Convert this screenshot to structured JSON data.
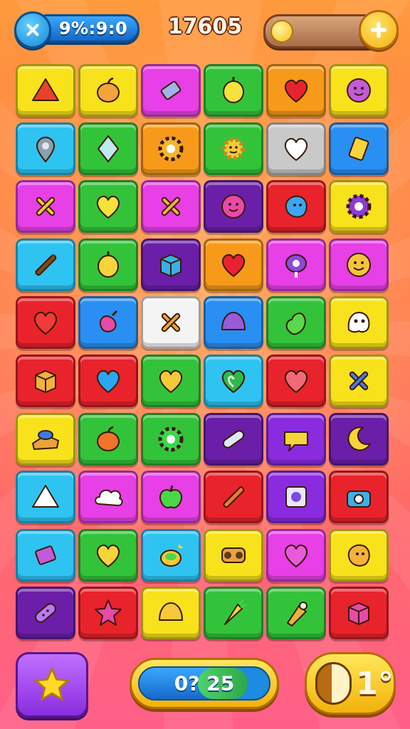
{
  "hud": {
    "timer": "9%:9:0",
    "score": "17605",
    "coins_value": ""
  },
  "colors": {
    "yellow": "#f7e21c",
    "green": "#33c33a",
    "magenta": "#e640e6",
    "orange": "#f79a1a",
    "cyan": "#2fc3f2",
    "purple": "#6b1fa8",
    "red": "#e9232b",
    "white": "#f4f4f4",
    "gray": "#c9c9c9",
    "blue": "#2a8ff2",
    "violet": "#8b2be0"
  },
  "board": {
    "rows": [
      [
        {
          "bg": "yellow",
          "icon": "triangle-gem-icon",
          "c": "#e8432a"
        },
        {
          "bg": "yellow",
          "icon": "fruit-icon",
          "c": "#f2a43a"
        },
        {
          "bg": "magenta",
          "icon": "candy-wrapper-icon",
          "c": "#9fb4e8"
        },
        {
          "bg": "green",
          "icon": "lemon-icon",
          "c": "#f6e23a"
        },
        {
          "bg": "orange",
          "icon": "heart-icon",
          "c": "#e8232f"
        },
        {
          "bg": "yellow",
          "icon": "smiley-gear-icon",
          "c": "#c35bd8"
        }
      ],
      [
        {
          "bg": "cyan",
          "icon": "map-pin-icon",
          "c": "#8aa0ad"
        },
        {
          "bg": "green",
          "icon": "diamond-gem-icon",
          "c": "#bfe8f0"
        },
        {
          "bg": "orange",
          "icon": "gear-icon",
          "c": "#f2b62a"
        },
        {
          "bg": "green",
          "icon": "sun-face-icon",
          "c": "#f6c93a"
        },
        {
          "bg": "gray",
          "icon": "heart-icon",
          "c": "#ffffff"
        },
        {
          "bg": "blue",
          "icon": "tag-icon",
          "c": "#f6d43a"
        }
      ],
      [
        {
          "bg": "magenta",
          "icon": "crossed-sticks-icon",
          "c": "#f2c43a"
        },
        {
          "bg": "green",
          "icon": "heart-icon",
          "c": "#f6e23a"
        },
        {
          "bg": "magenta",
          "icon": "crossed-sticks-icon",
          "c": "#f2b23a"
        },
        {
          "bg": "purple",
          "icon": "smiley-gear-icon",
          "c": "#e84aa8"
        },
        {
          "bg": "red",
          "icon": "blob-face-icon",
          "c": "#3aa7f2"
        },
        {
          "bg": "yellow",
          "icon": "gear-icon",
          "c": "#8b3ad8"
        }
      ],
      [
        {
          "bg": "cyan",
          "icon": "stick-icon",
          "c": "#7a4a1a"
        },
        {
          "bg": "green",
          "icon": "lemon-icon",
          "c": "#f6d43a"
        },
        {
          "bg": "purple",
          "icon": "box-icon",
          "c": "#3ab0e8"
        },
        {
          "bg": "orange",
          "icon": "heart-icon",
          "c": "#e8232f"
        },
        {
          "bg": "magenta",
          "icon": "key-icon",
          "c": "#8b4ad8"
        },
        {
          "bg": "magenta",
          "icon": "smiley-icon",
          "c": "#f6c43a"
        }
      ],
      [
        {
          "bg": "red",
          "icon": "heart-icon",
          "c": "#f13a3a"
        },
        {
          "bg": "blue",
          "icon": "bell-pepper-icon",
          "c": "#e84aa8"
        },
        {
          "bg": "white",
          "icon": "crossed-sticks-icon",
          "c": "#e8a43a"
        },
        {
          "bg": "blue",
          "icon": "dome-icon",
          "c": "#9b5ad8"
        },
        {
          "bg": "green",
          "icon": "pear-icon",
          "c": "#5ad84a"
        },
        {
          "bg": "yellow",
          "icon": "ghost-icon",
          "c": "#ffffff"
        }
      ],
      [
        {
          "bg": "red",
          "icon": "box-icon",
          "c": "#f2b23a"
        },
        {
          "bg": "red",
          "icon": "heart-icon",
          "c": "#2aa7f2"
        },
        {
          "bg": "green",
          "icon": "heart-icon",
          "c": "#f6c93a"
        },
        {
          "bg": "cyan",
          "icon": "leaf-heart-icon",
          "c": "#2fb84a"
        },
        {
          "bg": "red",
          "icon": "heart-icon",
          "c": "#f26a7a"
        },
        {
          "bg": "yellow",
          "icon": "crossed-sticks-icon",
          "c": "#4a7ae8"
        }
      ],
      [
        {
          "bg": "yellow",
          "icon": "cheese-helmet-icon",
          "c": "#e8a43a"
        },
        {
          "bg": "green",
          "icon": "fruit-icon",
          "c": "#f2742a"
        },
        {
          "bg": "green",
          "icon": "gear-icon",
          "c": "#3ad84a"
        },
        {
          "bg": "purple",
          "icon": "tube-icon",
          "c": "#e0e8f6"
        },
        {
          "bg": "violet",
          "icon": "speech-bubble-icon",
          "c": "#f6d43a"
        },
        {
          "bg": "purple",
          "icon": "moon-icon",
          "c": "#f6d43a"
        }
      ],
      [
        {
          "bg": "cyan",
          "icon": "triangle-gem-icon",
          "c": "#ffffff"
        },
        {
          "bg": "magenta",
          "icon": "cloud-icon",
          "c": "#ffffff"
        },
        {
          "bg": "magenta",
          "icon": "apple-icon",
          "c": "#4ad84a"
        },
        {
          "bg": "red",
          "icon": "stick-icon",
          "c": "#e87a3a"
        },
        {
          "bg": "violet",
          "icon": "frame-icon",
          "c": "#e8e8ff"
        },
        {
          "bg": "red",
          "icon": "camera-icon",
          "c": "#3ab0e8"
        }
      ],
      [
        {
          "bg": "cyan",
          "icon": "eraser-icon",
          "c": "#c35bd8"
        },
        {
          "bg": "green",
          "icon": "heart-icon",
          "c": "#f6d43a"
        },
        {
          "bg": "cyan",
          "icon": "pot-icon",
          "c": "#f6c93a"
        },
        {
          "bg": "yellow",
          "icon": "binoculars-icon",
          "c": "#e8a43a"
        },
        {
          "bg": "magenta",
          "icon": "heart-icon",
          "c": "#e85ad8"
        },
        {
          "bg": "yellow",
          "icon": "blob-face-icon",
          "c": "#f2b23a"
        }
      ],
      [
        {
          "bg": "purple",
          "icon": "bandage-icon",
          "c": "#b87af2"
        },
        {
          "bg": "red",
          "icon": "star-icon",
          "c": "#e84aa8"
        },
        {
          "bg": "yellow",
          "icon": "dome-icon",
          "c": "#f6c93a"
        },
        {
          "bg": "green",
          "icon": "carrot-icon",
          "c": "#f6d43a"
        },
        {
          "bg": "green",
          "icon": "shuttlecock-icon",
          "c": "#e8b43a"
        },
        {
          "bg": "red",
          "icon": "box-icon",
          "c": "#e84aa8"
        }
      ]
    ]
  },
  "bottom": {
    "progress_label": "0? 25",
    "progress_fraction": 0.78,
    "level_label": "1°"
  }
}
